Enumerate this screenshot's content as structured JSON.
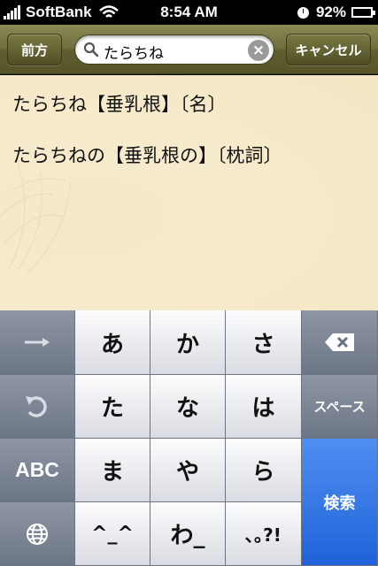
{
  "status_bar": {
    "carrier": "SoftBank",
    "time": "8:54 AM",
    "battery_percent": "92%",
    "battery_level": 0.92
  },
  "nav": {
    "back_label": "前方",
    "search_value": "たらちね",
    "cancel_label": "キャンセル"
  },
  "results": [
    "たらちね【垂乳根】〔名〕",
    "たらちねの【垂乳根の】〔枕詞〕"
  ],
  "keyboard": {
    "row1": [
      "あ",
      "か",
      "さ"
    ],
    "row2": [
      "た",
      "な",
      "は"
    ],
    "row3": [
      "ま",
      "や",
      "ら"
    ],
    "row4": [
      "^_^",
      "わ_",
      "､｡?!"
    ],
    "abc_label": "ABC",
    "space_label": "スペース",
    "search_label": "検索"
  }
}
